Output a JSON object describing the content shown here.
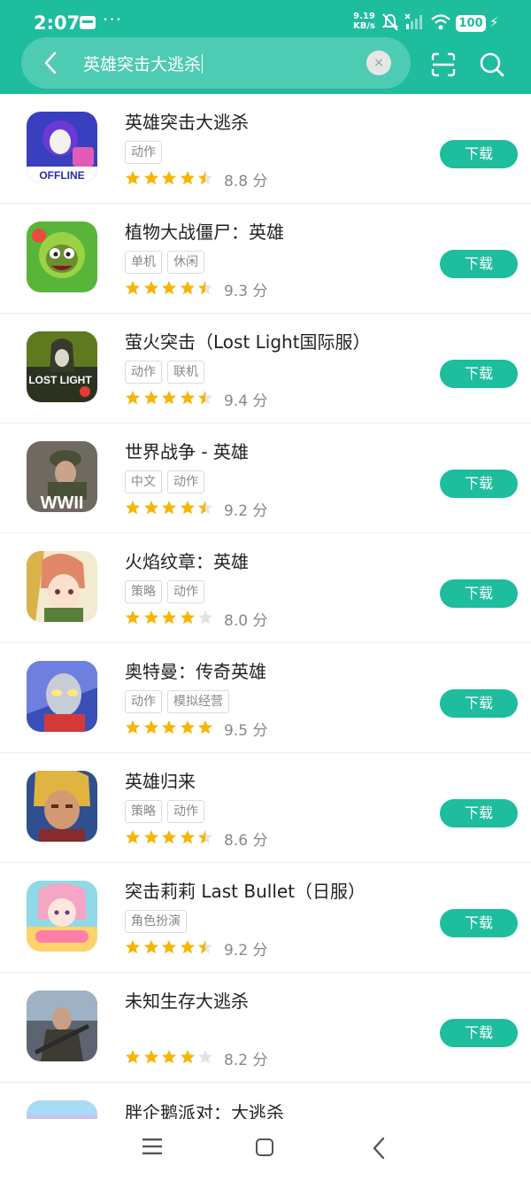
{
  "status_bar": {
    "time": "2:07",
    "dots": "···",
    "speed_top": "9.19",
    "speed_bottom": "KB/s",
    "battery": "100"
  },
  "search": {
    "query": "英雄突击大逃杀",
    "clear_symbol": "×"
  },
  "colors": {
    "accent": "#1dbd9e",
    "star_filled": "#f7b500",
    "star_empty": "#e2e2e2"
  },
  "results": [
    {
      "name": "英雄突击大逃杀",
      "tags": [
        "动作"
      ],
      "rating": 8.8,
      "score_text": "8.8 分",
      "stars": [
        1,
        1,
        1,
        1,
        0.5
      ],
      "download_label": "下载",
      "icon_label": "OFFLINE",
      "icon_name": "hero-strike-game-icon"
    },
    {
      "name": "植物大战僵尸：英雄",
      "tags": [
        "单机",
        "休闲"
      ],
      "rating": 9.3,
      "score_text": "9.3 分",
      "stars": [
        1,
        1,
        1,
        1,
        0.5
      ],
      "download_label": "下载",
      "icon_label": "",
      "icon_name": "pvz-heroes-game-icon"
    },
    {
      "name": "萤火突击（Lost Light国际服）",
      "tags": [
        "动作",
        "联机"
      ],
      "rating": 9.4,
      "score_text": "9.4 分",
      "stars": [
        1,
        1,
        1,
        1,
        0.5
      ],
      "download_label": "下载",
      "icon_label": "LOST LIGHT",
      "icon_name": "lost-light-game-icon"
    },
    {
      "name": "世界战争 - 英雄",
      "tags": [
        "中文",
        "动作"
      ],
      "rating": 9.2,
      "score_text": "9.2 分",
      "stars": [
        1,
        1,
        1,
        1,
        0.5
      ],
      "download_label": "下载",
      "icon_label": "WWII",
      "icon_name": "ww2-heroes-game-icon"
    },
    {
      "name": "火焰纹章：英雄",
      "tags": [
        "策略",
        "动作"
      ],
      "rating": 8.0,
      "score_text": "8.0 分",
      "stars": [
        1,
        1,
        1,
        1,
        0
      ],
      "download_label": "下载",
      "icon_label": "",
      "icon_name": "fire-emblem-heroes-game-icon"
    },
    {
      "name": "奥特曼：传奇英雄",
      "tags": [
        "动作",
        "模拟经营"
      ],
      "rating": 9.5,
      "score_text": "9.5 分",
      "stars": [
        1,
        1,
        1,
        1,
        1
      ],
      "download_label": "下载",
      "icon_label": "",
      "icon_name": "ultraman-game-icon"
    },
    {
      "name": "英雄归来",
      "tags": [
        "策略",
        "动作"
      ],
      "rating": 8.6,
      "score_text": "8.6 分",
      "stars": [
        1,
        1,
        1,
        1,
        0.5
      ],
      "download_label": "下载",
      "icon_label": "",
      "icon_name": "hero-returns-game-icon"
    },
    {
      "name": "突击莉莉 Last Bullet（日服）",
      "tags": [
        "角色扮演"
      ],
      "rating": 9.2,
      "score_text": "9.2 分",
      "stars": [
        1,
        1,
        1,
        1,
        0.5
      ],
      "download_label": "下载",
      "icon_label": "",
      "icon_name": "assault-lily-game-icon"
    },
    {
      "name": "未知生存大逃杀",
      "tags": [],
      "rating": 8.2,
      "score_text": "8.2 分",
      "stars": [
        1,
        1,
        1,
        1,
        0
      ],
      "download_label": "下载",
      "icon_label": "",
      "icon_name": "unknown-survival-game-icon"
    }
  ],
  "peek_item": {
    "name": "胖企鹅派对：大逃杀"
  },
  "nav": {
    "icons": [
      "menu-icon",
      "home-icon",
      "back-icon"
    ]
  }
}
